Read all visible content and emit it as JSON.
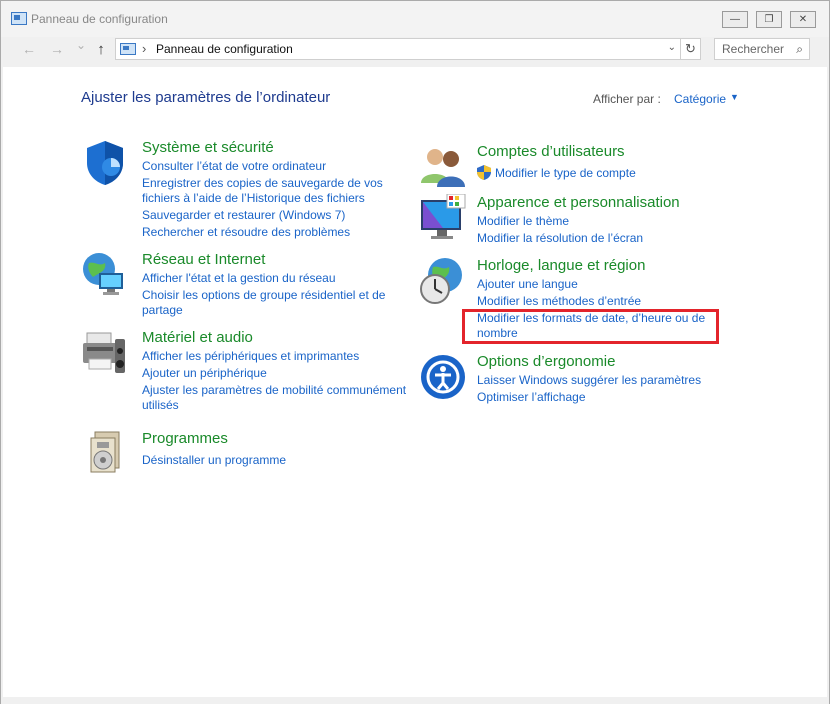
{
  "window": {
    "title": "Panneau de configuration",
    "buttons": {
      "minimize": "—",
      "restore": "❐",
      "close": "✕"
    }
  },
  "address_bar": {
    "back_icon": "←",
    "forward_icon": "→",
    "history_icon": "⌄",
    "up_icon": "↑",
    "separator": "›",
    "breadcrumb": "Panneau de configuration",
    "dropdown_icon": "⌄",
    "refresh_icon": "↻",
    "search_placeholder": "Rechercher",
    "search_icon": "⌕"
  },
  "header": {
    "title": "Ajuster les paramètres de l’ordinateur",
    "view_by_label": "Afficher par :",
    "view_by_value": "Catégorie",
    "view_by_arrow": "▼"
  },
  "categories": {
    "system": {
      "title": "Système et sécurité",
      "links": [
        "Consulter l’état de votre ordinateur",
        "Enregistrer des copies de sauvegarde de vos",
        "fichiers à l’aide de l’Historique des fichiers",
        "Sauvegarder et restaurer (Windows 7)",
        "Rechercher et résoudre des problèmes"
      ]
    },
    "network": {
      "title": "Réseau et Internet",
      "links": [
        "Afficher l'état et la gestion du réseau",
        "Choisir les options de groupe résidentiel et de",
        "partage"
      ]
    },
    "hardware": {
      "title": "Matériel et audio",
      "links": [
        "Afficher les périphériques et imprimantes",
        "Ajouter un périphérique",
        "Ajuster les paramètres de mobilité communément",
        "utilisés"
      ]
    },
    "programs": {
      "title": "Programmes",
      "links": [
        "Désinstaller un programme"
      ]
    },
    "accounts": {
      "title": "Comptes d’utilisateurs",
      "links": [
        "Modifier le type de compte"
      ]
    },
    "appearance": {
      "title": "Apparence et personnalisation",
      "links": [
        "Modifier le thème",
        "Modifier la résolution de l’écran"
      ]
    },
    "clock": {
      "title": "Horloge, langue et région",
      "links": [
        "Ajouter une langue",
        "Modifier les méthodes d’entrée",
        "Modifier les formats de date, d’heure ou de",
        "nombre"
      ]
    },
    "ease": {
      "title": "Options d’ergonomie",
      "links": [
        "Laisser Windows suggérer les paramètres",
        "Optimiser l’affichage"
      ]
    }
  },
  "colors": {
    "heading_green": "#1a8a2a",
    "link_blue": "#1a64c8",
    "title_blue": "#1e3b8f",
    "highlight_red": "#e3242b"
  }
}
